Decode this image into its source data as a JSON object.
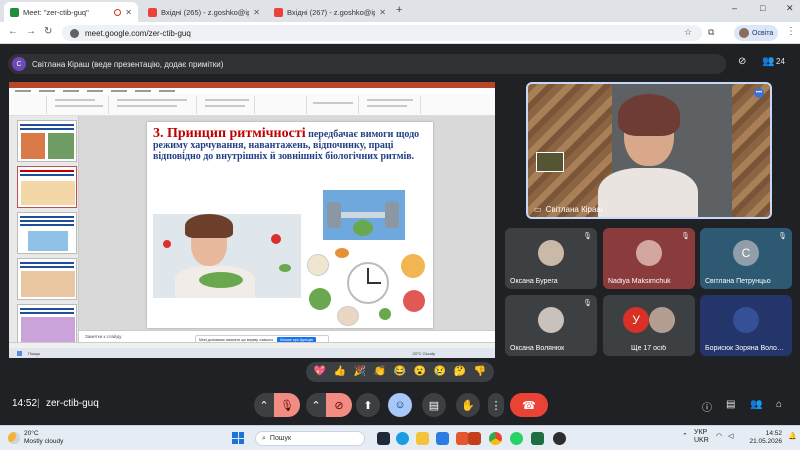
{
  "browser": {
    "tabs": [
      {
        "label": "Meet: \"zer-ctib-guq\"",
        "color": "#1e8e3e"
      },
      {
        "label": "Вхідні (265) - z.goshko@ippo.",
        "color": "#ea4335"
      },
      {
        "label": "Вхідні (267) - z.goshko@ippo.",
        "color": "#ea4335"
      }
    ],
    "new_tab": "+",
    "win_controls": [
      "–",
      "□",
      "✕"
    ],
    "url": "meet.google.com/zer-ctib-guq",
    "profile_label": "Освіта"
  },
  "meet": {
    "banner_initial": "С",
    "banner_text": "Світлана Кіраш (веде презентацію, додає примітки)",
    "participant_count": "24",
    "presenter_name": "Світлана Кіраш",
    "tiles": [
      {
        "name": "Оксана Бурега",
        "avatar": "",
        "avatar_color": "#c9b9a6"
      },
      {
        "name": "Nadiya Maksimchuk",
        "avatar": "",
        "avatar_color": "#d3a7a0"
      },
      {
        "name": "Світлана Петрунцьо",
        "avatar": "С",
        "avatar_color": "#8f9ea8"
      },
      {
        "name": "Оксана Волянюк",
        "avatar": "",
        "avatar_color": "#c8c2bb"
      },
      {
        "name": "Ще 17 осіб",
        "avatar": "У",
        "avatar_color": "#d93025"
      },
      {
        "name": "Борисюк Зоряна Воло…",
        "avatar": "",
        "avatar_color": "#355096"
      }
    ],
    "reactions": [
      "💖",
      "👍",
      "🎉",
      "👏",
      "😂",
      "😮",
      "😢",
      "🤔",
      "👎"
    ],
    "time": "14:52",
    "separator": "|",
    "meeting_code": "zer-ctib-guq"
  },
  "slide": {
    "heading": "3. Принцип ритмічності",
    "body": " передбачає вимоги щодо режиму харчування, навантажень, відпочинку, праці відповідно до внутрішніх й зовнішніх біологічних ритмів.",
    "notes_placeholder": "Заметки к слайду",
    "notif_text": "Meet допомагає засвоєти цю вправу з вашого",
    "notif_button": "Більше про функцію"
  },
  "inner_taskbar": {
    "search": "Пошук",
    "weather": "20°С Cloudy"
  },
  "taskbar": {
    "temperature": "20°C",
    "weather": "Mostly cloudy",
    "search_placeholder": "Пошук",
    "lang_top": "УКР",
    "lang_bottom": "UKR",
    "clock_time": "14:52",
    "clock_date": "21.05.2026"
  }
}
